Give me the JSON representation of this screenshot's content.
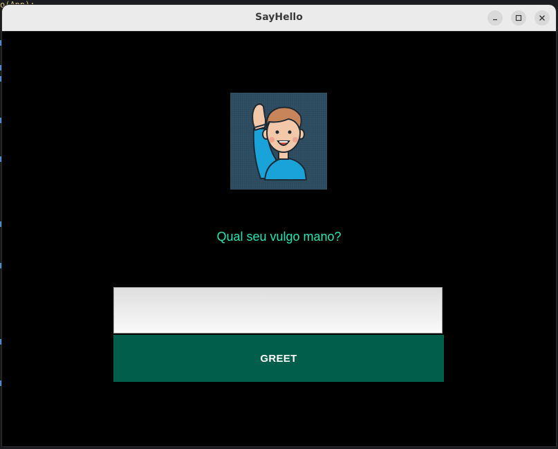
{
  "background": {
    "code_snippet": "o(App);"
  },
  "window": {
    "title": "SayHello",
    "controls": {
      "minimize_icon": "minimize-icon",
      "maximize_icon": "maximize-icon",
      "close_icon": "close-icon"
    }
  },
  "main": {
    "avatar_icon": "person-waving-icon",
    "prompt": "Qual seu vulgo mano?",
    "name_input": {
      "value": "",
      "placeholder": ""
    },
    "greet_button_label": "GREET"
  },
  "colors": {
    "window_background": "#000000",
    "prompt_text": "#1de9b6",
    "button_background": "#005e4a",
    "button_text": "#ffffff",
    "titlebar": "#ebebeb"
  }
}
